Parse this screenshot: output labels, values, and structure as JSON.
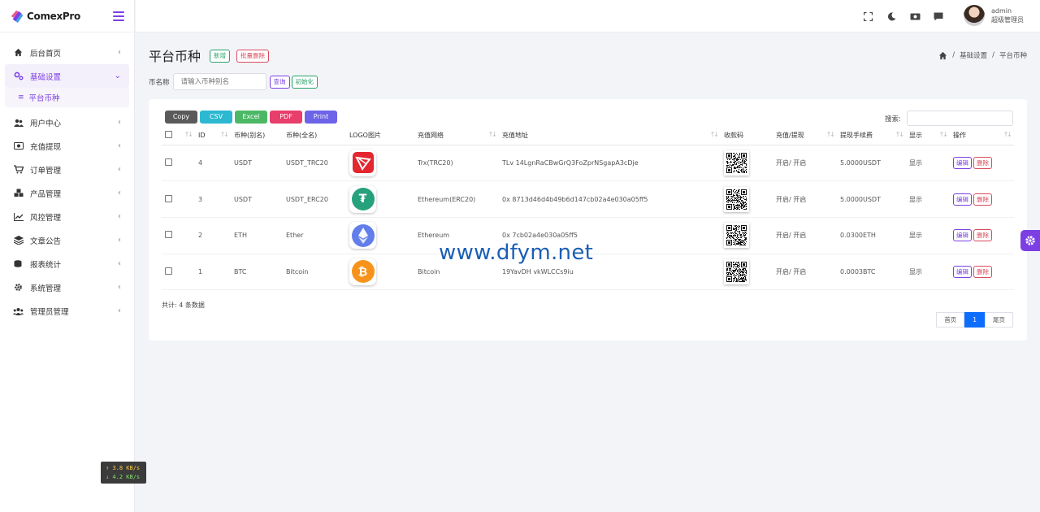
{
  "brand": {
    "name": "ComexPro",
    "accent": "#7b3fe4"
  },
  "sidebar": {
    "items": [
      {
        "label": "后台首页",
        "icon": "home-icon"
      },
      {
        "label": "基础设置",
        "icon": "cogs-icon",
        "active": true,
        "children": [
          {
            "label": "平台币种"
          }
        ]
      },
      {
        "label": "用户中心",
        "icon": "users-icon"
      },
      {
        "label": "充值提现",
        "icon": "money-icon"
      },
      {
        "label": "订单管理",
        "icon": "cart-icon"
      },
      {
        "label": "产品管理",
        "icon": "cubes-icon"
      },
      {
        "label": "风控管理",
        "icon": "chart-line-icon"
      },
      {
        "label": "文章公告",
        "icon": "layers-icon"
      },
      {
        "label": "报表统计",
        "icon": "coins-icon"
      },
      {
        "label": "系统管理",
        "icon": "gear-icon"
      },
      {
        "label": "管理员管理",
        "icon": "user-group-icon"
      }
    ]
  },
  "netspeed": {
    "up": "↑ 3.8 KB/s",
    "down": "↓ 4.2 KB/s"
  },
  "user": {
    "name": "admin",
    "role": "超级管理员"
  },
  "page": {
    "title": "平台币种",
    "new_label": "新增",
    "bulk_delete_label": "批量删除",
    "breadcrumb": [
      "基础设置",
      "平台币种"
    ]
  },
  "filter": {
    "label": "币名称",
    "placeholder": "请输入币种别名",
    "query_label": "查询",
    "init_label": "初始化"
  },
  "exports": [
    {
      "label": "Copy",
      "color": "#5a5a5a"
    },
    {
      "label": "CSV",
      "color": "#2bb8d0"
    },
    {
      "label": "Excel",
      "color": "#4cb866"
    },
    {
      "label": "PDF",
      "color": "#e83e6c"
    },
    {
      "label": "Print",
      "color": "#6c63e8"
    }
  ],
  "search": {
    "label": "搜索:"
  },
  "table": {
    "headers": [
      "ID",
      "币种(别名)",
      "币种(全名)",
      "LOGO图片",
      "充值网络",
      "充值地址",
      "收款码",
      "充值/提现",
      "提现手续费",
      "显示",
      "操作"
    ],
    "rows": [
      {
        "id": "4",
        "alias": "USDT",
        "full": "USDT_TRC20",
        "logo": "tron-logo-icon",
        "network": "Trx(TRC20)",
        "address": "TLv   14LgnRaCBwGrQ3FoZprNSgapA3cDje",
        "status": "开启/ 开启",
        "fee": "5.0000USDT",
        "display": "显示"
      },
      {
        "id": "3",
        "alias": "USDT",
        "full": "USDT_ERC20",
        "logo": "tether-logo-icon",
        "network": "Ethereum(ERC20)",
        "address": "0x        8713d46d4b49b6d147cb02a4e030a05ff5",
        "status": "开启/ 开启",
        "fee": "5.0000USDT",
        "display": "显示"
      },
      {
        "id": "2",
        "alias": "ETH",
        "full": "Ether",
        "logo": "ethereum-logo-icon",
        "network": "Ethereum",
        "address": "0x                   7cb02a4e030a05ff5",
        "status": "开启/ 开启",
        "fee": "0.0300ETH",
        "display": "显示"
      },
      {
        "id": "1",
        "alias": "BTC",
        "full": "Bitcoin",
        "logo": "bitcoin-logo-icon",
        "network": "Bitcoin",
        "address": "19YavDH               vkWLCCs9iu",
        "status": "开启/ 开启",
        "fee": "0.0003BTC",
        "display": "显示"
      }
    ],
    "edit_label": "编辑",
    "delete_label": "删除"
  },
  "total_text": "共计: 4 条数据",
  "pager": {
    "first": "首页",
    "current": "1",
    "last": "尾页"
  },
  "watermark": "www.dfym.net"
}
